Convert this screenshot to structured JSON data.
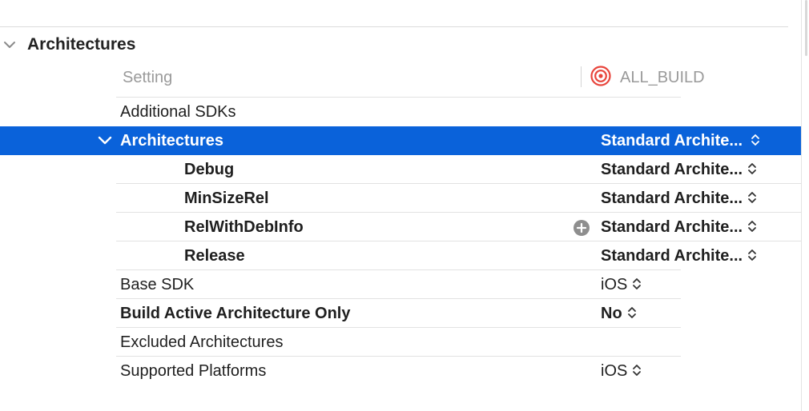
{
  "section": {
    "title": "Architectures"
  },
  "columns": {
    "setting": "Setting",
    "target": "ALL_BUILD"
  },
  "rows": {
    "additional_sdks": {
      "label": "Additional SDKs",
      "value": ""
    },
    "architectures": {
      "label": "Architectures",
      "value": "Standard Archite..."
    },
    "debug": {
      "label": "Debug",
      "value": "Standard Archite..."
    },
    "minsizerel": {
      "label": "MinSizeRel",
      "value": "Standard Archite..."
    },
    "relwithdebinfo": {
      "label": "RelWithDebInfo",
      "value": "Standard Archite..."
    },
    "release": {
      "label": "Release",
      "value": "Standard Archite..."
    },
    "base_sdk": {
      "label": "Base SDK",
      "value": "iOS"
    },
    "build_active_arch_only": {
      "label": "Build Active Architecture Only",
      "value": "No"
    },
    "excluded_architectures": {
      "label": "Excluded Architectures",
      "value": ""
    },
    "supported_platforms": {
      "label": "Supported Platforms",
      "value": "iOS"
    }
  },
  "colors": {
    "selection": "#0a62da",
    "target_icon": "#e8453c",
    "header_text": "#9a9a9a"
  },
  "icons": [
    "chevron-down-icon",
    "target-icon",
    "stepper-icon",
    "plus-circle-icon"
  ]
}
